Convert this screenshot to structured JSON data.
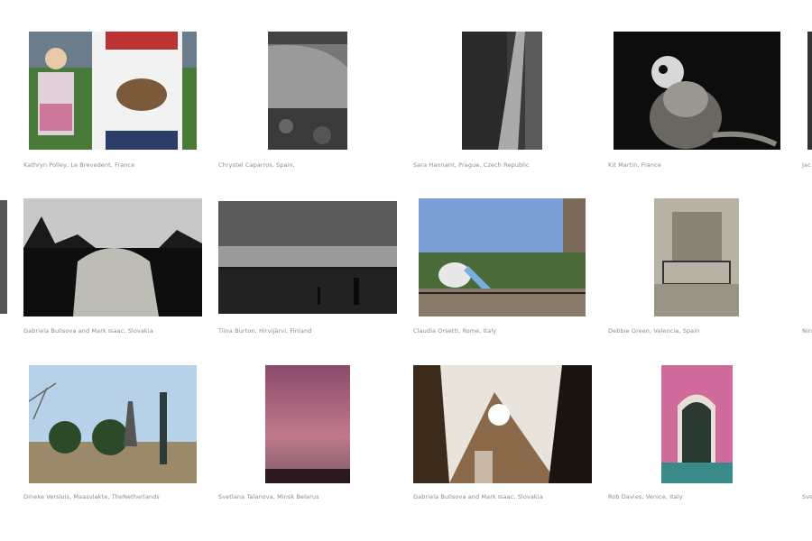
{
  "gallery": {
    "captions": [
      "Kathryn Polley, Le Brevedent, France",
      "Chrystel Caparros, Spain,",
      "Sara Hannant, Prague, Czech Republic",
      "Kit Martin, France",
      "Jac",
      "Gabriela Bulisova and Mark Isaac, Slovakia",
      "Tiina Burton, Hirvijärvi, Finland",
      "Claudia Orsetti, Rome, Italy",
      "Debbie Green, Valencia, Spain",
      "Nin",
      "Dineke Versluis, Maasvlakte, TheNetherlands",
      "Svetlana Talanova, Minsk Belarus",
      "Gabriela Bulisova and Mark Isaac, Slovakia",
      "Rob Davies, Venice, Italy",
      "Sve"
    ]
  }
}
